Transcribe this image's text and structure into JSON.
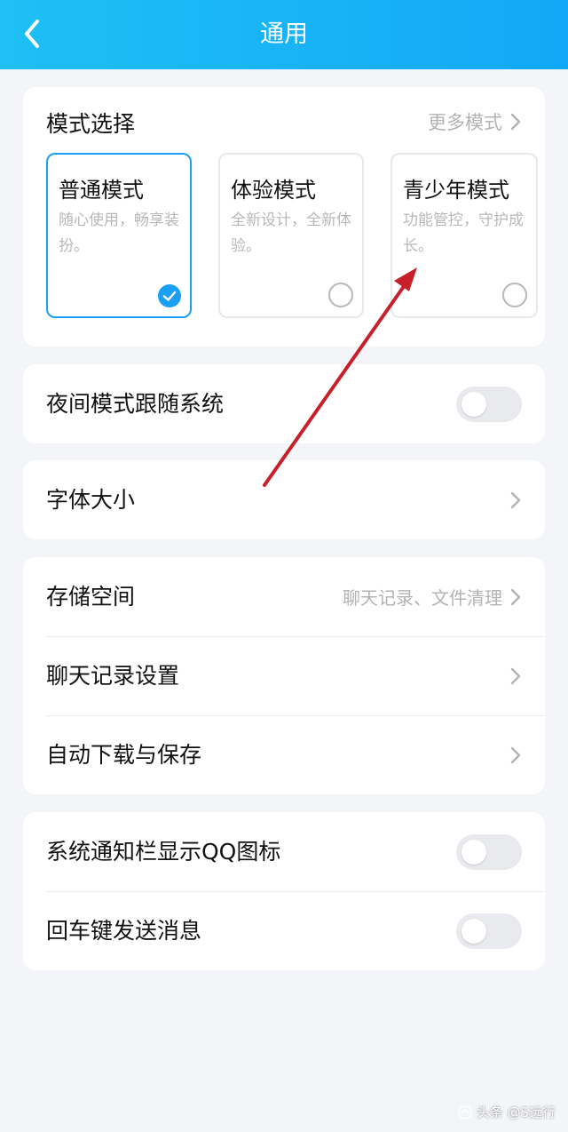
{
  "header": {
    "title": "通用"
  },
  "mode_section": {
    "title": "模式选择",
    "more_label": "更多模式",
    "modes": [
      {
        "name": "普通模式",
        "desc": "随心使用，畅享装扮。",
        "selected": true
      },
      {
        "name": "体验模式",
        "desc": "全新设计，全新体验。",
        "selected": false
      },
      {
        "name": "青少年模式",
        "desc": "功能管控，守护成长。",
        "selected": false
      }
    ]
  },
  "night_mode": {
    "label": "夜间模式跟随系统",
    "on": false
  },
  "font_size": {
    "label": "字体大小"
  },
  "storage_group": {
    "storage": {
      "label": "存储空间",
      "value": "聊天记录、文件清理"
    },
    "chat_history": {
      "label": "聊天记录设置"
    },
    "auto_download": {
      "label": "自动下载与保存"
    }
  },
  "notification_group": {
    "notify_icon": {
      "label": "系统通知栏显示QQ图标",
      "on": false
    },
    "enter_send": {
      "label": "回车键发送消息",
      "on": false
    }
  },
  "watermark": {
    "text": "头条 @S远行"
  },
  "colors": {
    "accent": "#1a9ff2",
    "header_start": "#1ec0f5",
    "header_end": "#13a8f7",
    "annotation_arrow": "#c8202a"
  }
}
